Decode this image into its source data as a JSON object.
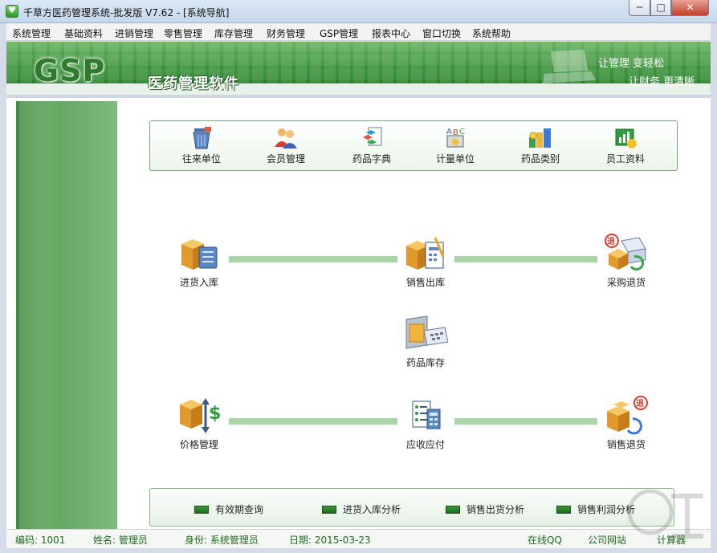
{
  "window": {
    "title": "千草方医药管理系统-批发版 V7.62 - [系统导航]",
    "controls": {
      "minimize": "─",
      "maximize": "□",
      "close": "✕"
    }
  },
  "menu": [
    "系统管理",
    "基础资料",
    "进销管理",
    "零售管理",
    "库存管理",
    "财务管理",
    "GSP管理",
    "报表中心",
    "窗口切换",
    "系统帮助"
  ],
  "banner": {
    "logo": "GSP",
    "product": "医药管理软件",
    "slogan_line1": "让管理 变轻松",
    "slogan_line2": "让财务 更清晰"
  },
  "tools": [
    {
      "label": "往来单位",
      "icon": "trash-bin-icon"
    },
    {
      "label": "会员管理",
      "icon": "members-icon"
    },
    {
      "label": "药品字典",
      "icon": "dictionary-icon"
    },
    {
      "label": "计量单位",
      "icon": "abc-unit-icon"
    },
    {
      "label": "药品类别",
      "icon": "category-icon"
    },
    {
      "label": "员工资料",
      "icon": "staff-chart-icon"
    }
  ],
  "flow": {
    "purchase_in": "进货入库",
    "sales_out": "销售出库",
    "purchase_return": "采购退货",
    "inventory": "药品库存",
    "price_mgmt": "价格管理",
    "receivable_payable": "应收应付",
    "sales_return": "销售退货",
    "return_badge": "退"
  },
  "bottom_links": [
    "有效期查询",
    "进货入库分析",
    "销售出货分析",
    "销售利润分析"
  ],
  "status": {
    "code_label": "编码:",
    "code_value": "1001",
    "name_label": "姓名:",
    "name_value": "管理员",
    "role_label": "身份:",
    "role_value": "系统管理员",
    "date_label": "日期:",
    "date_value": "2015-03-23",
    "qq": "在线QQ",
    "website": "公司网站",
    "calculator": "计算器"
  },
  "colors": {
    "brand_green": "#2f8a31",
    "flow_line": "#a9d4a8",
    "box_gold": "#e0a53a",
    "status_text": "#1e6b1e"
  }
}
